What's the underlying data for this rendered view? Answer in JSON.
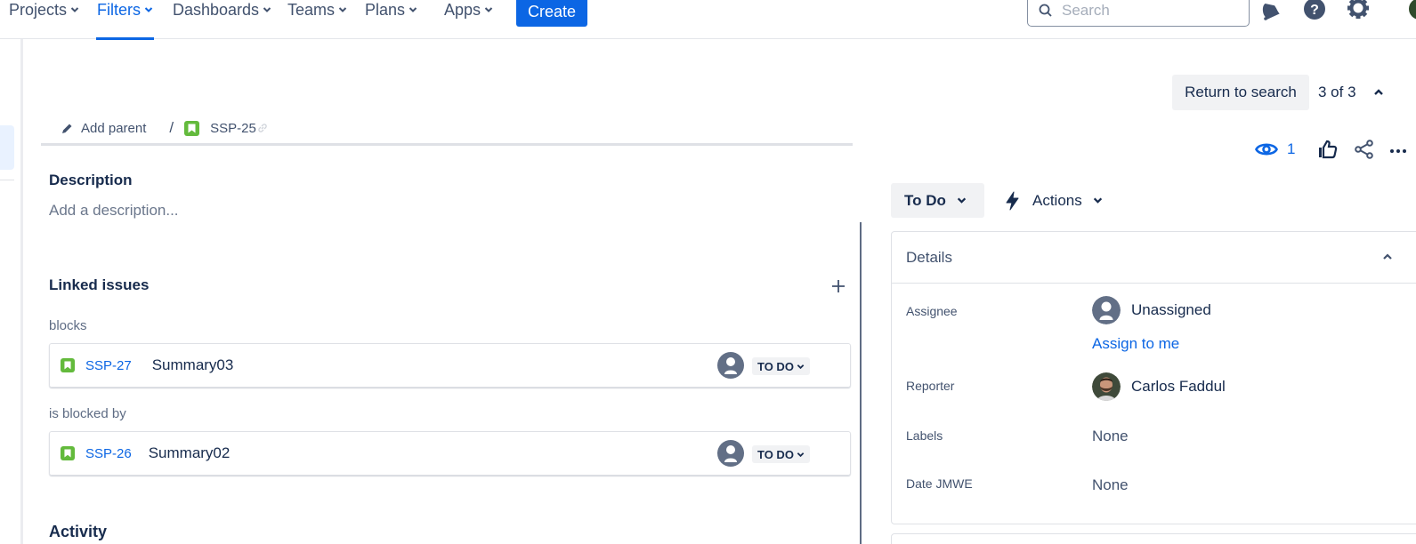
{
  "topnav": {
    "items": [
      {
        "label": "Projects",
        "active": false
      },
      {
        "label": "Filters",
        "active": true
      },
      {
        "label": "Dashboards",
        "active": false
      },
      {
        "label": "Teams",
        "active": false
      },
      {
        "label": "Plans",
        "active": false
      },
      {
        "label": "Apps",
        "active": false
      }
    ],
    "create_label": "Create",
    "search_placeholder": "Search",
    "search_value": "",
    "icons": [
      "notifications-icon",
      "help-icon",
      "settings-icon",
      "profile-avatar"
    ]
  },
  "breadcrumb": {
    "add_parent_label": "Add parent",
    "separator": "/",
    "issue_key": "SSP-25"
  },
  "description": {
    "title": "Description",
    "placeholder": "Add a description..."
  },
  "linked_issues": {
    "title": "Linked issues",
    "groups": [
      {
        "label": "blocks",
        "issues": [
          {
            "key": "SSP-27",
            "summary": "Summary03",
            "status": "TO DO",
            "assignee": "Unassigned"
          }
        ]
      },
      {
        "label": "is blocked by",
        "issues": [
          {
            "key": "SSP-26",
            "summary": "Summary02",
            "status": "TO DO",
            "assignee": "Unassigned"
          }
        ]
      }
    ]
  },
  "activity": {
    "title": "Activity"
  },
  "navigation": {
    "return_label": "Return to search",
    "pager": "3 of 3"
  },
  "toolbar": {
    "watchers_count": "1"
  },
  "status": {
    "current": "To Do",
    "actions_label": "Actions"
  },
  "details": {
    "title": "Details",
    "fields": [
      {
        "label": "Assignee",
        "value": "Unassigned",
        "action": "Assign to me"
      },
      {
        "label": "Reporter",
        "value": "Carlos Faddul"
      },
      {
        "label": "Labels",
        "value": "None"
      },
      {
        "label": "Date JMWE",
        "value": "None"
      }
    ]
  },
  "colors": {
    "brand_blue": "#0c66e4",
    "story_green": "#63ba3c",
    "text_primary": "#172b4d",
    "text_subtle": "#42526e",
    "neutral_bg": "#f1f2f4"
  }
}
